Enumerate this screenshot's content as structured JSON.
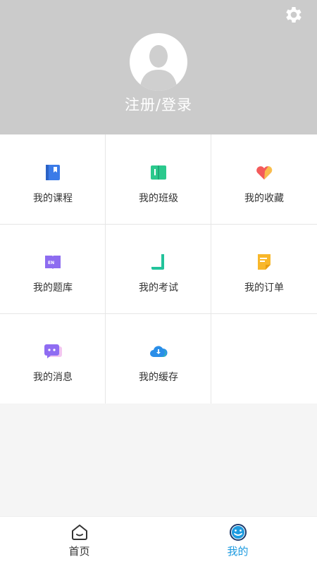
{
  "header": {
    "settings_icon": "gear-icon",
    "avatar_icon": "default-user-avatar",
    "login_text": "注册/登录"
  },
  "grid": {
    "items": [
      {
        "label": "我的课程",
        "icon": "book-icon",
        "color": "#3b7be8"
      },
      {
        "label": "我的班级",
        "icon": "open-book-icon",
        "color": "#2bc98d"
      },
      {
        "label": "我的收藏",
        "icon": "heart-icon",
        "color": "#f35a5a"
      },
      {
        "label": "我的题库",
        "icon": "en-book-icon",
        "color": "#8d6cf0"
      },
      {
        "label": "我的考试",
        "icon": "scroll-icon",
        "color": "#22c39b"
      },
      {
        "label": "我的订单",
        "icon": "note-icon",
        "color": "#f8b72a"
      },
      {
        "label": "我的消息",
        "icon": "chat-icon",
        "color": "#8f6cf2"
      },
      {
        "label": "我的缓存",
        "icon": "cloud-download-icon",
        "color": "#2a8ee8"
      }
    ]
  },
  "tabbar": {
    "tabs": [
      {
        "label": "首页",
        "icon": "home-icon",
        "active": false
      },
      {
        "label": "我的",
        "icon": "smiley-icon",
        "active": true
      }
    ],
    "active_color": "#1e9be0",
    "inactive_color": "#333333"
  }
}
